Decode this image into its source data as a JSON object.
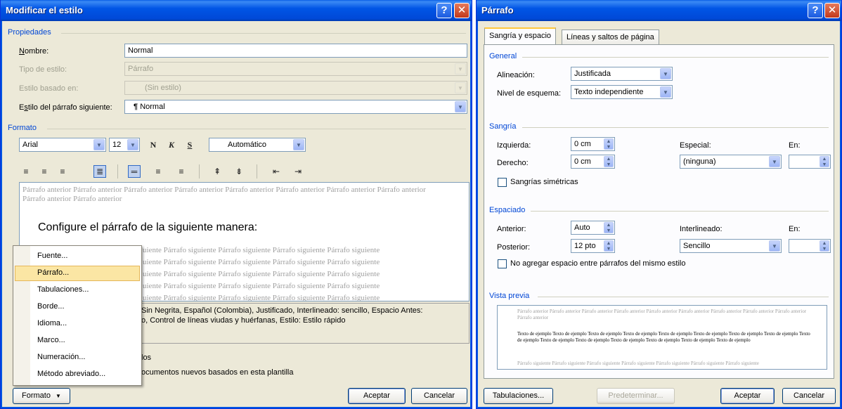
{
  "style_dialog": {
    "title": "Modificar el estilo",
    "help_btn": "?",
    "close_btn": "✕",
    "properties": {
      "group": "Propiedades",
      "name_label": "Nombre:",
      "name_value": "Normal",
      "type_label": "Tipo de estilo:",
      "type_value": "Párrafo",
      "based_label": "Estilo basado en:",
      "based_value": "(Sin estilo)",
      "next_label": "Estilo del párrafo siguiente:",
      "next_icon": "¶",
      "next_value": "Normal"
    },
    "format": {
      "group": "Formato",
      "font": "Arial",
      "size": "12",
      "bold": "N",
      "italic": "K",
      "underline": "S",
      "color": "Automático"
    },
    "preview": {
      "prev_para": "Párrafo anterior Párrafo anterior Párrafo anterior Párrafo anterior Párrafo anterior Párrafo anterior Párrafo anterior Párrafo anterior Párrafo anterior Párrafo anterior",
      "main_text": "Configure el párrafo de la siguiente manera:",
      "next_line": "uiente Párrafo siguiente Párrafo siguiente Párrafo siguiente Párrafo siguiente"
    },
    "description_line1": "Sin Negrita, Español (Colombia), Justificado, Interlineado:  sencillo, Espacio Antes:",
    "description_line2": "o, Control de líneas viudas y huérfanas, Estilo: Estilo rápido",
    "option1_tail": "los",
    "option2_tail": "ocumentos nuevos basados en esta plantilla",
    "format_btn": "Formato",
    "ok_btn": "Aceptar",
    "cancel_btn": "Cancelar",
    "menu": [
      "Fuente...",
      "Párrafo...",
      "Tabulaciones...",
      "Borde...",
      "Idioma...",
      "Marco...",
      "Numeración...",
      "Método abreviado..."
    ]
  },
  "para_dialog": {
    "title": "Párrafo",
    "help_btn": "?",
    "close_btn": "✕",
    "tab1": "Sangría y espacio",
    "tab2": "Líneas y saltos de página",
    "general": {
      "group": "General",
      "align_label": "Alineación:",
      "align_value": "Justificada",
      "level_label": "Nivel de esquema:",
      "level_value": "Texto independiente"
    },
    "indent": {
      "group": "Sangría",
      "left_label": "Izquierda:",
      "left_value": "0 cm",
      "right_label": "Derecho:",
      "right_value": "0 cm",
      "special_label": "Especial:",
      "special_value": "(ninguna)",
      "by_label": "En:",
      "mirror_label": "Sangrías simétricas"
    },
    "spacing": {
      "group": "Espaciado",
      "before_label": "Anterior:",
      "before_value": "Auto",
      "after_label": "Posterior:",
      "after_value": "12 pto",
      "line_label": "Interlineado:",
      "line_value": "Sencillo",
      "at_label": "En:",
      "no_space_label": "No agregar espacio entre párrafos del mismo estilo"
    },
    "preview": {
      "group": "Vista previa",
      "prev_text": "Párrafo anterior Párrafo anterior Párrafo anterior Párrafo anterior Párrafo anterior Párrafo anterior Párrafo anterior Párrafo anterior Párrafo anterior Párrafo anterior",
      "sample_text": "Texto de ejemplo Texto de ejemplo Texto de ejemplo Texto de ejemplo Texto de ejemplo Texto de ejemplo Texto de ejemplo Texto de ejemplo Texto de ejemplo Texto de ejemplo Texto de ejemplo Texto de ejemplo Texto de ejemplo Texto de ejemplo Texto de ejemplo",
      "next_text": "Párrafo siguiente Párrafo siguiente Párrafo siguiente Párrafo siguiente Párrafo siguiente Párrafo siguiente Párrafo siguiente"
    },
    "tabs_btn": "Tabulaciones...",
    "default_btn": "Predeterminar...",
    "ok_btn": "Aceptar",
    "cancel_btn": "Cancelar"
  },
  "colors": {
    "title_bar": "#0055e5",
    "group_label": "#0046d5",
    "dialog_bg": "#ece9d8",
    "menu_highlight": "#fbe6a4"
  }
}
